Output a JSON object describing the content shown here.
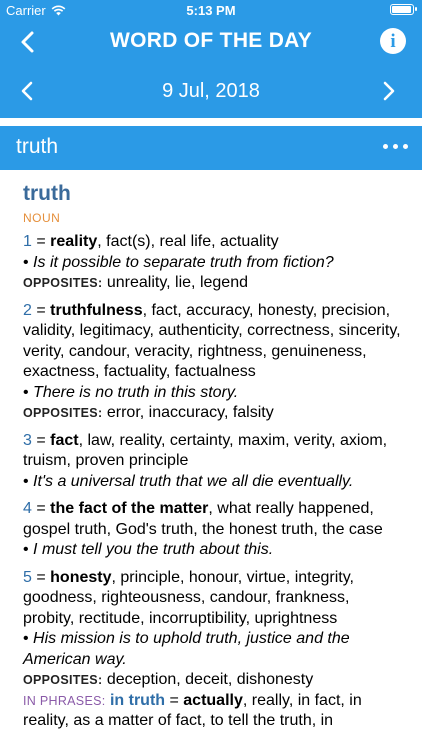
{
  "status_bar": {
    "carrier": "Carrier",
    "time": "5:13 PM",
    "battery_level": 1.0
  },
  "nav": {
    "title": "WORD OF THE DAY"
  },
  "date_bar": {
    "date": "9 Jul, 2018"
  },
  "headword_bar": {
    "word": "truth"
  },
  "entry": {
    "word": "truth",
    "pos": "NOUN",
    "opposites_label": "OPPOSITES:",
    "senses": [
      {
        "num": "1",
        "eq": " = ",
        "head": "reality",
        "rest": ", fact(s), real life, actuality",
        "example": "Is it possible to separate truth from fiction?",
        "opposites": "unreality, lie, legend"
      },
      {
        "num": "2",
        "eq": " = ",
        "head": "truthfulness",
        "rest": ", fact, accuracy, honesty, precision, validity, legitimacy, authenticity, correctness, sincerity, verity, candour, veracity, rightness, genuineness, exactness, factuality, factualness",
        "example": "There is no truth in this story.",
        "opposites": "error, inaccuracy, falsity"
      },
      {
        "num": "3",
        "eq": " = ",
        "head": "fact",
        "rest": ", law, reality, certainty, maxim, verity, axiom, truism, proven principle",
        "example": "It's a universal truth that we all die eventually."
      },
      {
        "num": "4",
        "eq": " = ",
        "head": "the fact of the matter",
        "rest": ", what really happened, gospel truth, God's truth, the honest truth, the case",
        "example": "I must tell you the truth about this."
      },
      {
        "num": "5",
        "eq": " = ",
        "head": "honesty",
        "rest": ", principle, honour, virtue, integrity, goodness, righteousness, candour, frankness, probity, rectitude, incorruptibility, uprightness",
        "example": "His mission is to uphold truth, justice and the American way.",
        "opposites": "deception, deceit, dishonesty"
      }
    ],
    "phrases": {
      "label": "IN PHRASES:",
      "phrase": "in truth",
      "eq": " = ",
      "head": "actually",
      "rest": ", really, in fact, in reality, as a matter of fact, to tell the truth, in"
    }
  }
}
